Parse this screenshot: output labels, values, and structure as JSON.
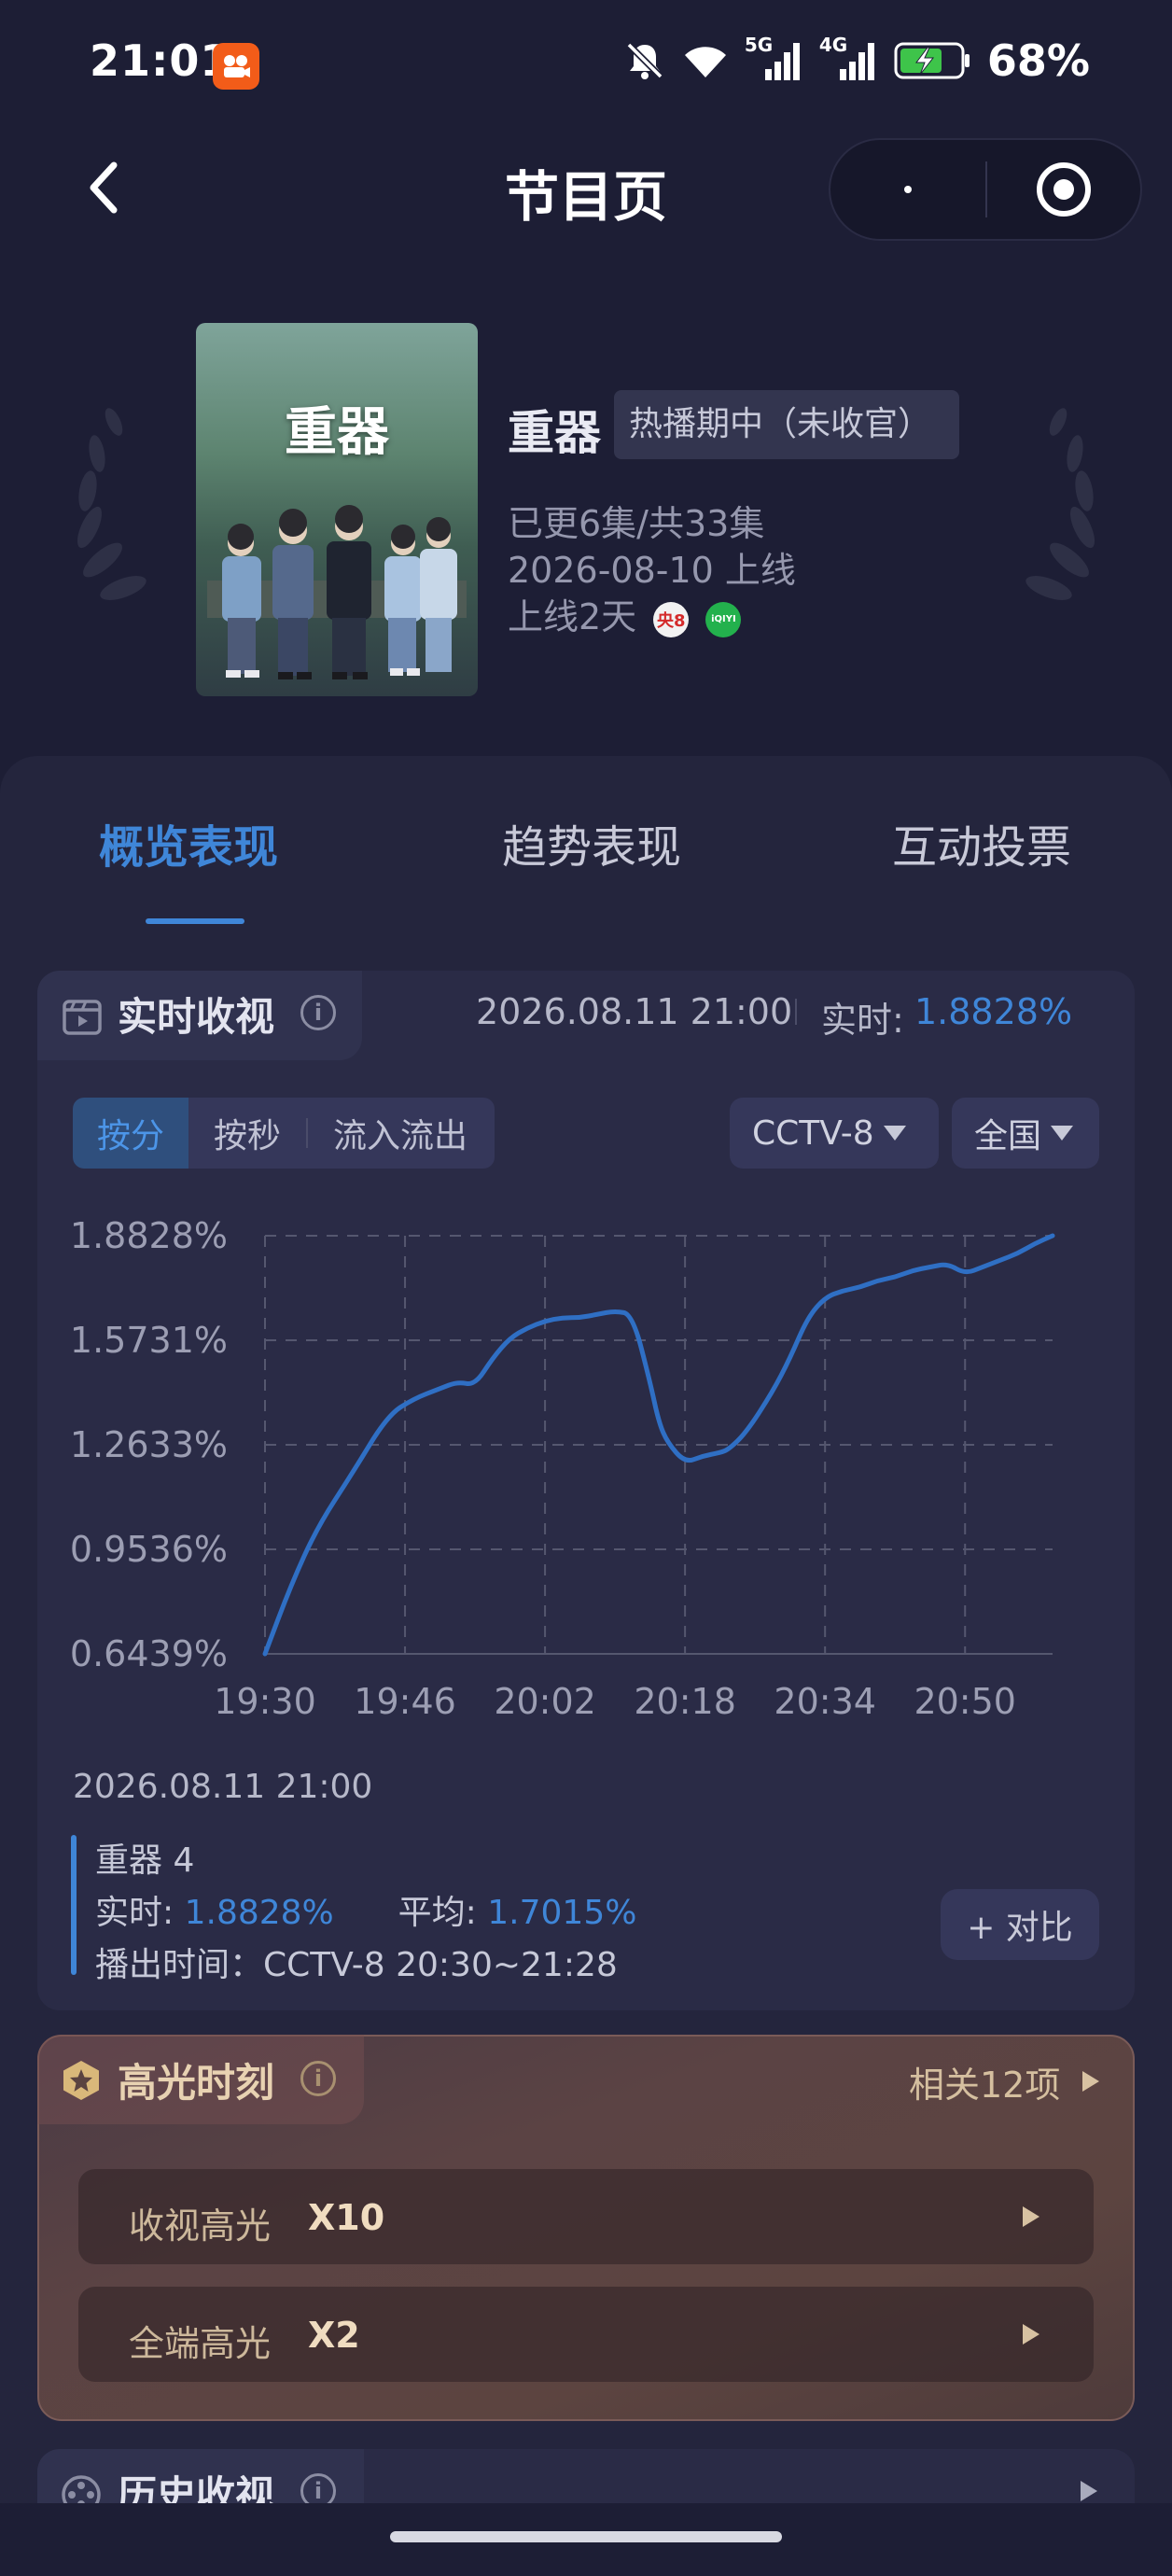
{
  "status_bar": {
    "time": "21:01",
    "network_5g": "5G",
    "network_4g": "4G",
    "battery": "68%",
    "icons": [
      "app-notification-icon",
      "mute-bell-icon",
      "wifi-icon",
      "signal-5g-icon",
      "signal-4g-icon",
      "battery-charging-icon"
    ]
  },
  "nav": {
    "title": "节目页",
    "back_icon": "chevron-left-icon",
    "more_icon": "dot-icon",
    "close_icon": "target-circle-icon"
  },
  "show": {
    "poster_title": "重器",
    "name": "重器",
    "status_tag": "热播期中（未收官）",
    "episodes": "已更6集/共33集",
    "premiere": "2026-08-10 上线",
    "online_days": "上线2天",
    "channel_badges": [
      "央8",
      "iQIYI"
    ]
  },
  "tabs": [
    {
      "label": "概览表现",
      "active": true
    },
    {
      "label": "趋势表现",
      "active": false
    },
    {
      "label": "互动投票",
      "active": false
    }
  ],
  "realtime": {
    "title": "实时收视",
    "timestamp": "2026.08.11 21:00",
    "rt_label": "实时:",
    "rt_value": "1.8828%",
    "segments": [
      "按分",
      "按秒",
      "流入流出"
    ],
    "channel": "CCTV-8",
    "region": "全国",
    "legend_time": "2026.08.11 21:00",
    "legend_name": "重器 4",
    "legend_rt_label": "实时:",
    "legend_rt_value": "1.8828%",
    "legend_avg_label": "平均:",
    "legend_avg_value": "1.7015%",
    "airtime": "播出时间：CCTV-8 20:30~21:28",
    "compare_button": "+ 对比"
  },
  "chart_data": {
    "type": "line",
    "x_ticks": [
      "19:30",
      "19:46",
      "20:02",
      "20:18",
      "20:34",
      "20:50"
    ],
    "y_ticks": [
      "1.8828%",
      "1.5731%",
      "1.2633%",
      "0.9536%",
      "0.6439%"
    ],
    "ylim": [
      0.6439,
      1.8828
    ],
    "xlim_minutes": [
      0,
      90
    ],
    "grid": true,
    "series": [
      {
        "color": "#2f6fc4",
        "x": [
          0,
          3,
          6,
          10,
          14,
          17,
          20,
          22,
          24,
          26,
          28,
          30,
          32,
          34,
          36,
          38,
          40,
          42,
          44,
          45,
          46,
          48,
          50,
          52,
          53,
          55,
          58,
          60,
          62,
          64,
          66,
          68,
          70,
          72,
          74,
          76,
          78,
          80,
          82,
          84,
          86,
          88,
          90
        ],
        "y": [
          0.6439,
          0.85,
          1.02,
          1.18,
          1.35,
          1.4,
          1.43,
          1.45,
          1.44,
          1.52,
          1.58,
          1.61,
          1.63,
          1.64,
          1.64,
          1.65,
          1.66,
          1.65,
          1.45,
          1.33,
          1.27,
          1.21,
          1.23,
          1.24,
          1.25,
          1.3,
          1.42,
          1.52,
          1.64,
          1.7,
          1.72,
          1.73,
          1.75,
          1.76,
          1.78,
          1.79,
          1.8,
          1.77,
          1.79,
          1.81,
          1.83,
          1.86,
          1.8828
        ]
      }
    ]
  },
  "highlights": {
    "title": "高光时刻",
    "related": "相关12项",
    "rows": [
      {
        "label": "收视高光",
        "value": "X10"
      },
      {
        "label": "全端高光",
        "value": "X2"
      }
    ]
  },
  "history": {
    "title": "历史收视"
  },
  "colors": {
    "background": "#1d1e35",
    "accent": "#3f86d8",
    "card": "#2a2b46",
    "highlight_gold": "#e8d2b2"
  }
}
